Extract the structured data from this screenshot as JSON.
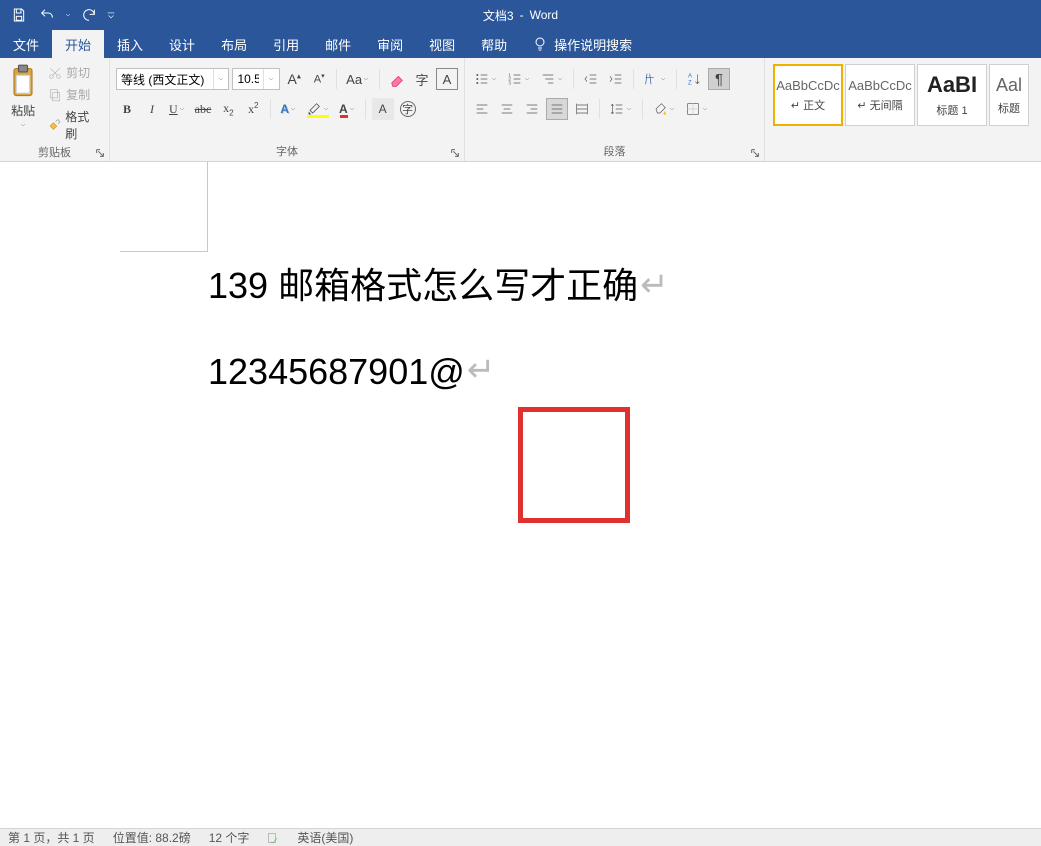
{
  "app": {
    "doc_name": "文档3",
    "app_name": "Word"
  },
  "tabs": {
    "file": "文件",
    "items": [
      "开始",
      "插入",
      "设计",
      "布局",
      "引用",
      "邮件",
      "审阅",
      "视图",
      "帮助"
    ],
    "active_index": 0,
    "tell_me": "操作说明搜索"
  },
  "clipboard": {
    "paste": "粘贴",
    "cut": "剪切",
    "copy": "复制",
    "format_painter": "格式刷",
    "label": "剪贴板"
  },
  "font": {
    "name": "等线 (西文正文)",
    "size": "10.5",
    "label": "字体"
  },
  "paragraph": {
    "label": "段落"
  },
  "styles": {
    "items": [
      {
        "preview": "AaBbCcDc",
        "label": "↵ 正文"
      },
      {
        "preview": "AaBbCcDc",
        "label": "↵ 无间隔"
      },
      {
        "preview": "AaBI",
        "label": "标题 1"
      },
      {
        "preview": "Aal",
        "label": "标题"
      }
    ]
  },
  "document": {
    "line1": "139 邮箱格式怎么写才正确",
    "line2": "12345687901@"
  },
  "status": {
    "page": "第 1 页，共 1 页",
    "position": "位置值: 88.2磅",
    "words": "12 个字",
    "language": "英语(美国)"
  }
}
